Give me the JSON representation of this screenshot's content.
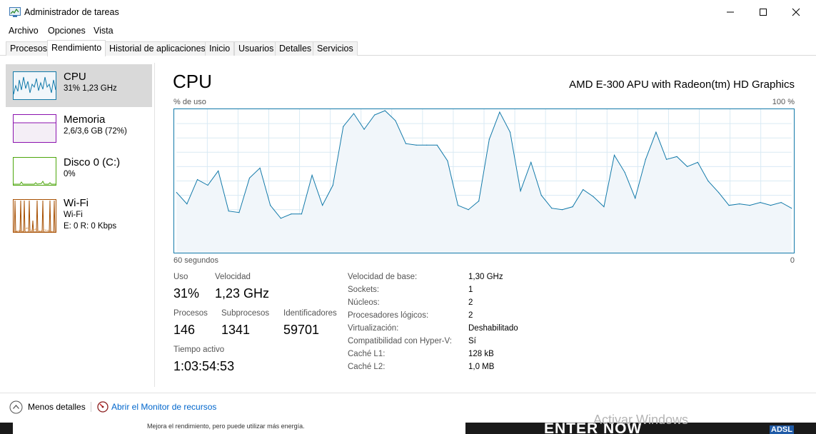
{
  "window": {
    "title": "Administrador de tareas",
    "icon": "task-manager-icon"
  },
  "menu": [
    "Archivo",
    "Opciones",
    "Vista"
  ],
  "tabs": [
    "Procesos",
    "Rendimiento",
    "Historial de aplicaciones",
    "Inicio",
    "Usuarios",
    "Detalles",
    "Servicios"
  ],
  "active_tab": "Rendimiento",
  "sidebar": {
    "items": [
      {
        "title": "CPU",
        "sub1": "31% 1,23 GHz",
        "sub2": "",
        "selected": true,
        "color": "#1179a9"
      },
      {
        "title": "Memoria",
        "sub1": "2,6/3,6 GB (72%)",
        "sub2": "",
        "selected": false,
        "color": "#8b12ae"
      },
      {
        "title": "Disco 0 (C:)",
        "sub1": "0%",
        "sub2": "",
        "selected": false,
        "color": "#4da60c"
      },
      {
        "title": "Wi-Fi",
        "sub1": "Wi-Fi",
        "sub2": "E: 0 R: 0 Kbps",
        "selected": false,
        "color": "#a74f01"
      }
    ]
  },
  "main": {
    "title": "CPU",
    "processor": "AMD E-300 APU with Radeon(tm) HD Graphics",
    "graph_label_top": "% de uso",
    "graph_label_max": "100 %",
    "graph_label_time": "60 segundos",
    "graph_label_zero": "0",
    "stats": {
      "usage_label": "Uso",
      "usage": "31%",
      "speed_label": "Velocidad",
      "speed": "1,23 GHz",
      "procs_label": "Procesos",
      "procs": "146",
      "threads_label": "Subprocesos",
      "threads": "1341",
      "handles_label": "Identificadores",
      "handles": "59701",
      "uptime_label": "Tiempo activo",
      "uptime": "1:03:54:53"
    },
    "specs": [
      {
        "key": "Velocidad de base:",
        "value": "1,30 GHz"
      },
      {
        "key": "Sockets:",
        "value": "1"
      },
      {
        "key": "Núcleos:",
        "value": "2"
      },
      {
        "key": "Procesadores lógicos:",
        "value": "2"
      },
      {
        "key": "Virtualización:",
        "value": "Deshabilitado"
      },
      {
        "key": "Compatibilidad con Hyper-V:",
        "value": "Sí"
      },
      {
        "key": "Caché L1:",
        "value": "128 kB"
      },
      {
        "key": "Caché L2:",
        "value": "1,0 MB"
      }
    ]
  },
  "footer": {
    "less_details": "Menos detalles",
    "resource_monitor": "Abrir el Monitor de recursos"
  },
  "background": {
    "hint": "Mejora el rendimiento, pero puede utilizar más energía.",
    "banner": "ENTER NOW",
    "watermark": "Activar Windows",
    "badge": "ADSL"
  },
  "chart_data": {
    "type": "area",
    "title": "CPU",
    "ylabel": "% de uso",
    "xlabel": "60 segundos",
    "ylim": [
      0,
      100
    ],
    "x_range_seconds": [
      60,
      0
    ],
    "series": [
      {
        "values": [
          42,
          34,
          51,
          47,
          57,
          29,
          28,
          52,
          59,
          33,
          24,
          27,
          27,
          54,
          33,
          47,
          88,
          97,
          86,
          96,
          99,
          92,
          76,
          75,
          75,
          75,
          64,
          33,
          30,
          36,
          79,
          98,
          84,
          43,
          63,
          40,
          31,
          30,
          32,
          44,
          39,
          32,
          68,
          56,
          38,
          65,
          84,
          65,
          67,
          60,
          63,
          50,
          42,
          33,
          34,
          33,
          35,
          33,
          35,
          31
        ]
      }
    ],
    "grid": true
  }
}
